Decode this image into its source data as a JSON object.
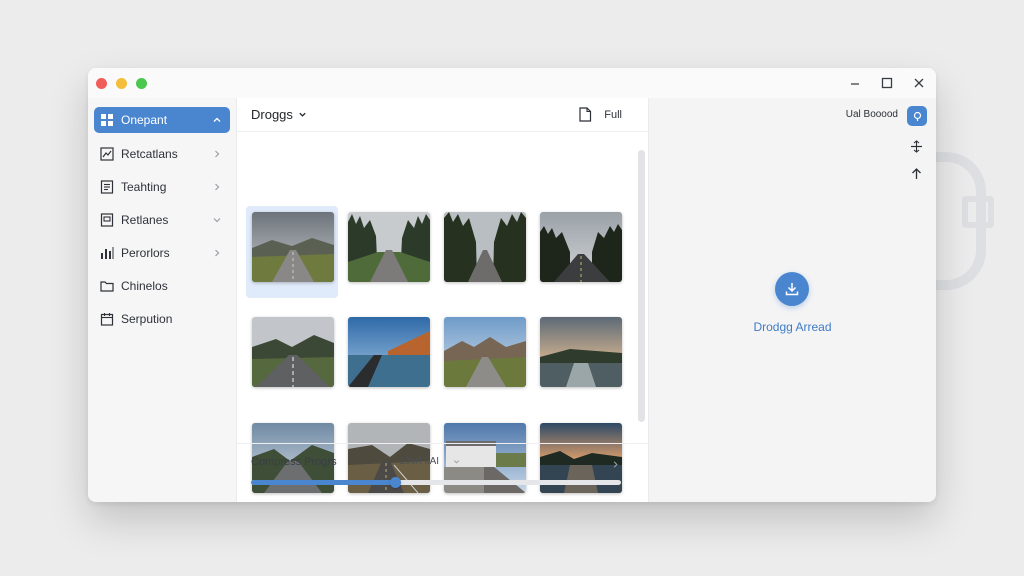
{
  "window": {
    "controls": [
      "minimize",
      "maximize",
      "close"
    ]
  },
  "sidebar": {
    "items": [
      {
        "label": "Onepant",
        "icon": "grid-icon",
        "active": true
      },
      {
        "label": "Retcatlans",
        "icon": "chart-icon",
        "active": false
      },
      {
        "label": "Teahting",
        "icon": "document-icon",
        "active": false
      },
      {
        "label": "Retlanes",
        "icon": "note-icon",
        "active": false
      },
      {
        "label": "Perorlors",
        "icon": "bar-chart-icon",
        "active": false
      },
      {
        "label": "Chinelos",
        "icon": "folder-icon",
        "active": false
      },
      {
        "label": "Serpution",
        "icon": "calendar-icon",
        "active": false
      }
    ]
  },
  "gallery": {
    "folder_label": "Droggs",
    "full_label": "Full",
    "thumbnails": [
      {
        "name": "cloudy-road",
        "selected": true
      },
      {
        "name": "forest-road",
        "selected": false
      },
      {
        "name": "pine-road",
        "selected": false
      },
      {
        "name": "dark-pine-road",
        "selected": false
      },
      {
        "name": "hill-highway",
        "selected": false
      },
      {
        "name": "lake-cliff",
        "selected": false
      },
      {
        "name": "mountain-road",
        "selected": false
      },
      {
        "name": "sunset-lake",
        "selected": false
      },
      {
        "name": "valley-road",
        "selected": false
      },
      {
        "name": "rail-hills",
        "selected": false
      },
      {
        "name": "village-road",
        "selected": false
      },
      {
        "name": "dusk-lake",
        "selected": false
      }
    ],
    "progress": {
      "label": "Compress Progrs",
      "option": "10ort κΑΙ",
      "value": 0.39
    }
  },
  "right_panel": {
    "title": "Ual Booood",
    "drop_label": "Drodgg Arread"
  },
  "colors": {
    "accent": "#4a86cf",
    "selection": "#dfeafa"
  }
}
